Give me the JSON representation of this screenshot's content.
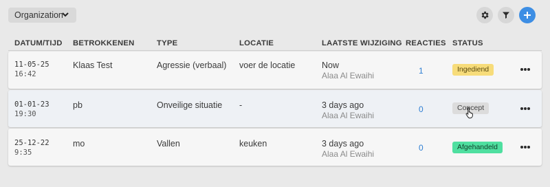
{
  "toolbar": {
    "org_label": "Organization",
    "gear_icon": "gear-icon",
    "filter_icon": "filter-icon",
    "add_icon": "plus-icon"
  },
  "table": {
    "headers": [
      "DATUM/TIJD",
      "BETROKKENEN",
      "TYPE",
      "LOCATIE",
      "LAATSTE WIJZIGING",
      "REACTIES",
      "STATUS"
    ],
    "rows": [
      {
        "date": "11-05-25",
        "time": "16:42",
        "betrokkenen": "Klaas Test",
        "type": "Agressie (verbaal)",
        "locatie": "voer de locatie",
        "wijziging": "Now",
        "wijziging_by": "Alaa Al Ewaihi",
        "reacties": "1",
        "status": "Ingediend",
        "status_color": "#f7dc7a"
      },
      {
        "date": "01-01-23",
        "time": "19:30",
        "betrokkenen": "pb",
        "type": "Onveilige situatie",
        "locatie": "-",
        "wijziging": "3 days ago",
        "wijziging_by": "Alaa Al Ewaihi",
        "reacties": "0",
        "status": "Concept",
        "status_color": "#dcdcdc"
      },
      {
        "date": "25-12-22",
        "time": "9:35",
        "betrokkenen": "mo",
        "type": "Vallen",
        "locatie": "keuken",
        "wijziging": "3 days ago",
        "wijziging_by": "Alaa Al Ewaihi",
        "reacties": "0",
        "status": "Afgehandeld",
        "status_color": "#4fdfa0"
      }
    ]
  },
  "colors": {
    "accent": "#3d8ee4",
    "reacties_link": "#2f7fd3"
  }
}
